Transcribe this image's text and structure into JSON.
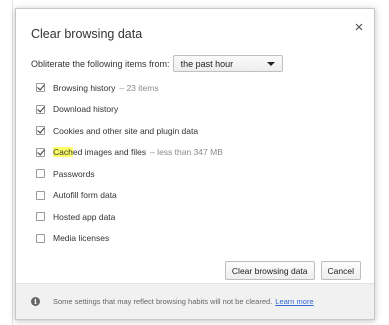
{
  "dialog": {
    "title": "Clear browsing data",
    "close_icon": "close-icon",
    "time_range": {
      "label": "Obliterate the following items from:",
      "selected": "the past hour"
    },
    "items": [
      {
        "id": "browsing-history",
        "label": "Browsing history",
        "meta": "– 23 items",
        "checked": true
      },
      {
        "id": "download-history",
        "label": "Download history",
        "meta": "",
        "checked": true
      },
      {
        "id": "cookies",
        "label": "Cookies and other site and plugin data",
        "meta": "",
        "checked": true
      },
      {
        "id": "cached",
        "label_highlight": "Cach",
        "label_rest": "ed images and files",
        "meta": "– less than 347 MB",
        "checked": true
      },
      {
        "id": "passwords",
        "label": "Passwords",
        "meta": "",
        "checked": false
      },
      {
        "id": "autofill",
        "label": "Autofill form data",
        "meta": "",
        "checked": false
      },
      {
        "id": "hosted-app",
        "label": "Hosted app data",
        "meta": "",
        "checked": false
      },
      {
        "id": "media-licenses",
        "label": "Media licenses",
        "meta": "",
        "checked": false
      }
    ],
    "buttons": {
      "clear": "Clear browsing data",
      "cancel": "Cancel"
    },
    "footer": {
      "icon": "info-icon",
      "text": "Some settings that may reflect browsing habits will not be cleared.",
      "link": "Learn more"
    }
  }
}
